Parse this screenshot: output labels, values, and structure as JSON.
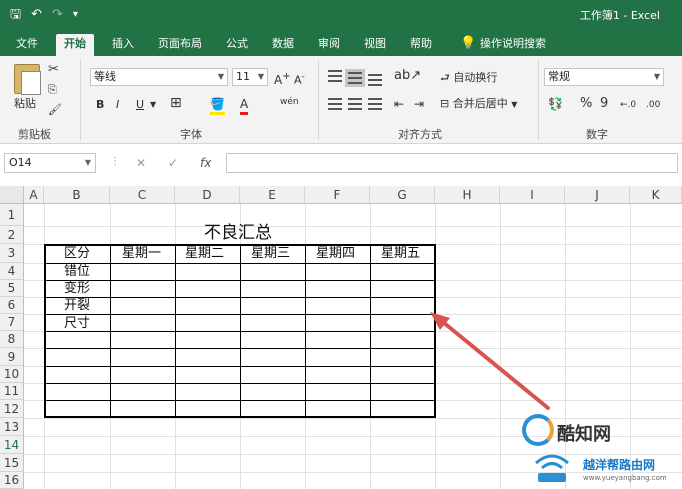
{
  "window": {
    "title": "工作簿1 - Excel"
  },
  "qat": {
    "save_icon": "save-icon",
    "undo_icon": "undo-icon",
    "redo_icon": "redo-icon"
  },
  "tabs": [
    {
      "label": "文件"
    },
    {
      "label": "开始"
    },
    {
      "label": "插入"
    },
    {
      "label": "页面布局"
    },
    {
      "label": "公式"
    },
    {
      "label": "数据"
    },
    {
      "label": "审阅"
    },
    {
      "label": "视图"
    },
    {
      "label": "帮助"
    },
    {
      "label": "操作说明搜索"
    }
  ],
  "ribbon": {
    "clipboard": {
      "paste": "粘贴",
      "label": "剪贴板"
    },
    "font": {
      "name": "等线",
      "size": "11",
      "bold": "B",
      "italic": "I",
      "underline": "U",
      "font_color_letter": "A",
      "label": "字体"
    },
    "alignment": {
      "wrap": "自动换行",
      "merge": "合并后居中",
      "label": "对齐方式"
    },
    "number": {
      "format": "常规",
      "percent": "%",
      "comma": "9",
      "label": "数字"
    }
  },
  "formula_bar": {
    "name_box": "O14",
    "fx": "fx"
  },
  "columns": [
    "A",
    "B",
    "C",
    "D",
    "E",
    "F",
    "G",
    "H",
    "I",
    "J",
    "K"
  ],
  "rows": [
    "1",
    "2",
    "3",
    "4",
    "5",
    "6",
    "7",
    "8",
    "9",
    "10",
    "11",
    "12",
    "13",
    "14",
    "15",
    "16"
  ],
  "sheet": {
    "title": "不良汇总",
    "header": [
      "区分",
      "星期一",
      "星期二",
      "星期三",
      "星期四",
      "星期五"
    ],
    "row_labels": [
      "错位",
      "变形",
      "开裂",
      "尺寸"
    ]
  },
  "watermark": {
    "brand": "酷知网",
    "site_cn": "越洋帮路由网",
    "site_url": "www.yueyangbang.com"
  }
}
